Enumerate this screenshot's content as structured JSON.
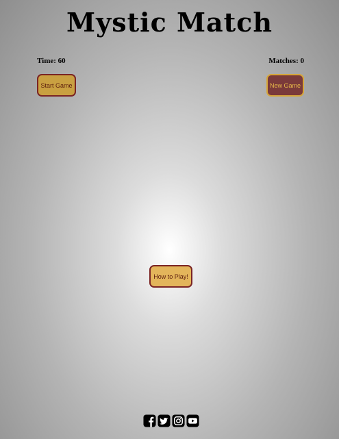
{
  "title": "Mystic Match",
  "stats": {
    "time_label": "Time: 60",
    "matches_label": "Matches: 0"
  },
  "buttons": {
    "start": "Start Game",
    "new": "New Game",
    "how": "How to Play!"
  },
  "social": [
    {
      "icon": "facebook-icon"
    },
    {
      "icon": "twitter-icon"
    },
    {
      "icon": "instagram-icon"
    },
    {
      "icon": "youtube-icon"
    }
  ],
  "colors": {
    "start_bg": "#c9a041",
    "new_bg": "#7a3a3a",
    "how_bg": "#e3b55b",
    "accent_border": "#7a2424"
  }
}
